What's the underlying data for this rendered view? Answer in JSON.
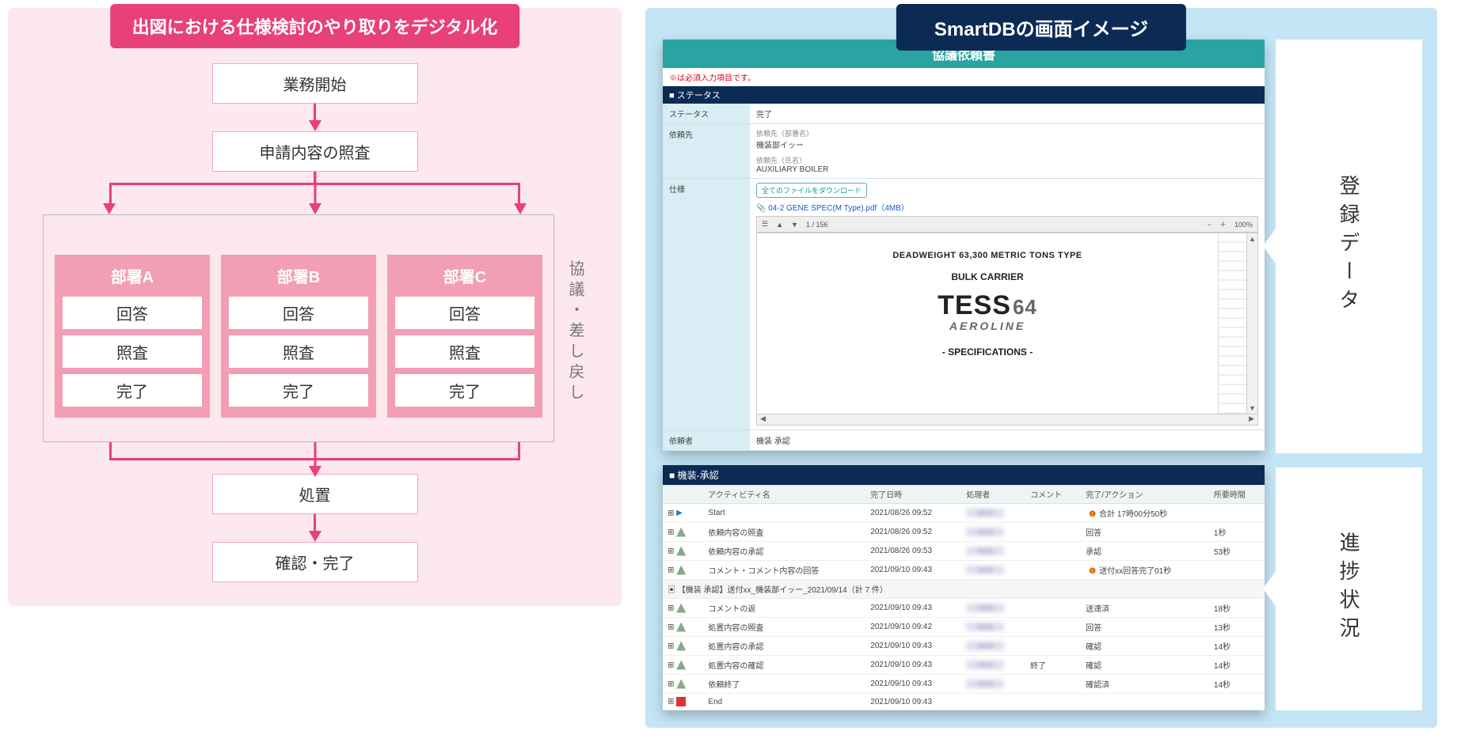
{
  "left": {
    "header": "出図における仕様検討のやり取りをデジタル化",
    "steps": {
      "start": "業務開始",
      "review": "申請内容の照査",
      "action": "処置",
      "done": "確認・完了"
    },
    "side_label": "協議・差し戻し",
    "departments": [
      {
        "name": "部署A",
        "s1": "回答",
        "s2": "照査",
        "s3": "完了"
      },
      {
        "name": "部署B",
        "s1": "回答",
        "s2": "照査",
        "s3": "完了"
      },
      {
        "name": "部署C",
        "s1": "回答",
        "s2": "照査",
        "s3": "完了"
      }
    ]
  },
  "right": {
    "header": "SmartDBの画面イメージ",
    "callouts": {
      "top": "登録データ",
      "bottom": "進捗状況"
    },
    "form": {
      "title": "協議依頼書",
      "required_note": "※は必須入力項目です。",
      "section1": "■ ステータス",
      "rows": {
        "status_label": "ステータス",
        "status_value": "完了",
        "requester_label": "依頼先",
        "requester_line1": "依頼先（部署名）",
        "requester_line2": "機装部イッー",
        "requester_line3": "依頼先（氏名）",
        "requester_line4": "AUXILIARY BOILER",
        "spec_label": "仕様"
      },
      "download_btn": "全てのファイルをダウンロード",
      "filename": "04-2 GENE SPEC(M Type).pdf（4MB）",
      "toolbar": {
        "page": "1",
        "total": "156",
        "zoom": "100%"
      },
      "pdf": {
        "line1": "DEADWEIGHT 63,300 METRIC TONS TYPE",
        "line2": "BULK CARRIER",
        "logo_main": "TESS",
        "logo_num": "64",
        "logo_sub": "AEROLINE",
        "line3": "- SPECIFICATIONS -"
      },
      "last_row_label": "依頼者",
      "last_row_value": "機装 承認"
    },
    "progress": {
      "header": "■ 機装-承認",
      "columns": [
        "",
        "アクティビティ名",
        "完了日時",
        "処理者",
        "コメント",
        "完了/アクション",
        "所要時間"
      ],
      "group_row": "【機装 承認】送付xx_機装部イッー_2021/09/14（計 7 件）",
      "rows": [
        {
          "icon": "play",
          "act": "Start",
          "date": "2021/08/26 09:52",
          "p": "blur",
          "cmt": "",
          "res": "合計 17時00分50秒",
          "warn": true,
          "dur": ""
        },
        {
          "icon": "tree",
          "act": "依頼内容の照査",
          "date": "2021/08/26 09:52",
          "p": "blur",
          "cmt": "",
          "res": "回答",
          "dur": "1秒"
        },
        {
          "icon": "tree",
          "act": "依頼内容の承認",
          "date": "2021/08/26 09:53",
          "p": "blur",
          "cmt": "",
          "res": "承認",
          "dur": "53秒"
        },
        {
          "icon": "tree",
          "act": "コメント・コメント内容の回答",
          "date": "2021/09/10 09:43",
          "p": "blur",
          "cmt": "",
          "res": "送付xx回答完了01秒",
          "warn": true,
          "dur": ""
        },
        {
          "icon": "tree",
          "act": "コメントの返",
          "date": "2021/09/10 09:43",
          "p": "blur",
          "cmt": "",
          "res": "送達済",
          "dur": "18秒"
        },
        {
          "icon": "tree",
          "act": "処置内容の照査",
          "date": "2021/09/10 09:42",
          "p": "blur",
          "cmt": "",
          "res": "回答",
          "dur": "13秒"
        },
        {
          "icon": "tree",
          "act": "処置内容の承認",
          "date": "2021/09/10 09:43",
          "p": "blur",
          "cmt": "",
          "res": "確認",
          "dur": "14秒"
        },
        {
          "icon": "tree",
          "act": "処置内容の確認",
          "date": "2021/09/10 09:43",
          "p": "blur",
          "cmt": "終了",
          "res": "確認",
          "dur": "14秒"
        },
        {
          "icon": "tree",
          "act": "依頼終了",
          "date": "2021/09/10 09:43",
          "p": "blur",
          "cmt": "",
          "res": "確認済",
          "dur": "14秒"
        },
        {
          "icon": "stop",
          "act": "End",
          "date": "2021/09/10 09:43",
          "p": "",
          "cmt": "",
          "res": "",
          "dur": ""
        }
      ]
    }
  }
}
